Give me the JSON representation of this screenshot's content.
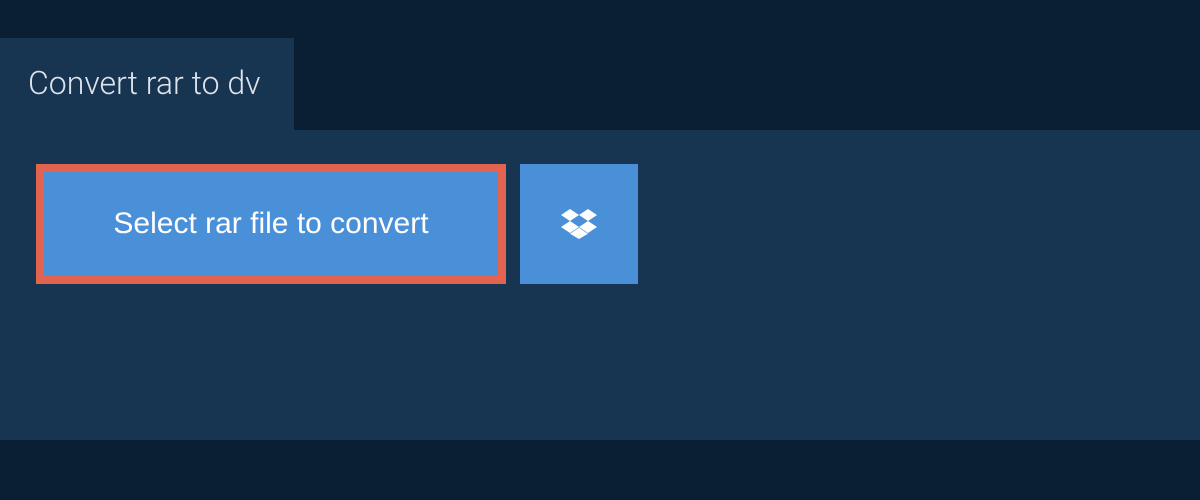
{
  "header": {
    "tab_label": "Convert rar to dv"
  },
  "actions": {
    "select_file_label": "Select rar file to convert",
    "dropbox_name": "dropbox"
  },
  "colors": {
    "background": "#0a1f33",
    "panel": "#173450",
    "button": "#4a90d9",
    "highlight_border": "#e06450",
    "text_light": "#dce3ea",
    "text_white": "#ffffff"
  }
}
